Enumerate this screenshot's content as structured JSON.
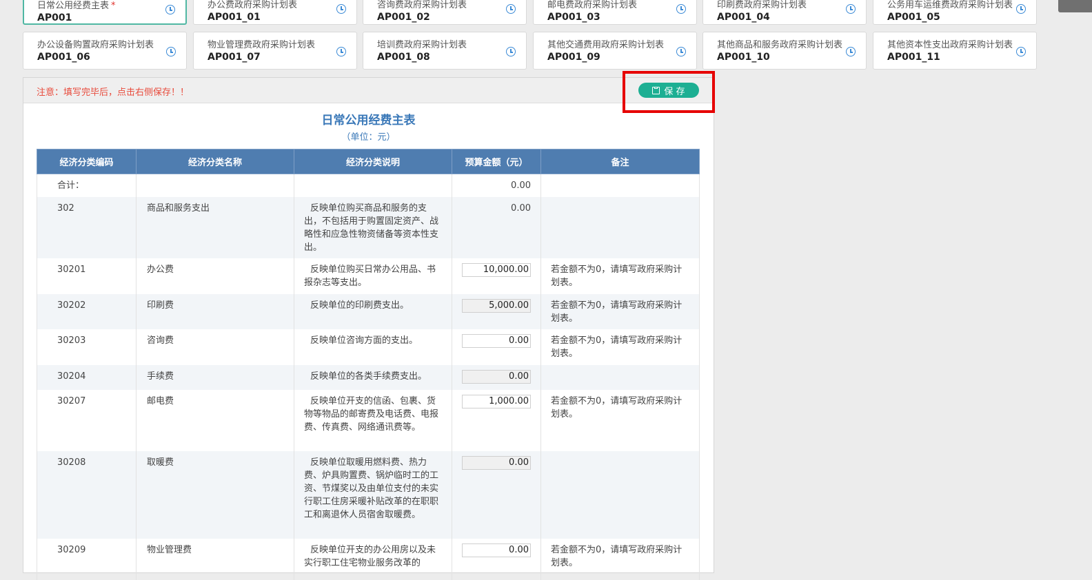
{
  "cards": [
    {
      "title": "日常公用经费主表",
      "code": "AP001",
      "required_mark": "*"
    },
    {
      "title": "办公费政府采购计划表",
      "code": "AP001_01"
    },
    {
      "title": "咨询费政府采购计划表",
      "code": "AP001_02"
    },
    {
      "title": "邮电费政府采购计划表",
      "code": "AP001_03"
    },
    {
      "title": "印刷费政府采购计划表",
      "code": "AP001_04"
    },
    {
      "title": "公务用车运维费政府采购计划表",
      "code": "AP001_05"
    },
    {
      "title": "办公设备购置政府采购计划表",
      "code": "AP001_06"
    },
    {
      "title": "物业管理费政府采购计划表",
      "code": "AP001_07"
    },
    {
      "title": "培训费政府采购计划表",
      "code": "AP001_08"
    },
    {
      "title": "其他交通费用政府采购计划表",
      "code": "AP001_09"
    },
    {
      "title": "其他商品和服务政府采购计划表",
      "code": "AP001_10"
    },
    {
      "title": "其他资本性支出政府采购计划表",
      "code": "AP001_11"
    }
  ],
  "notice": "注意：填写完毕后，点击右侧保存！！",
  "save_label": "保 存",
  "sheet": {
    "title": "日常公用经费主表",
    "unit": "（单位：元）",
    "headers": [
      "经济分类编码",
      "经济分类名称",
      "经济分类说明",
      "预算金额（元）",
      "备注"
    ],
    "rows": [
      {
        "code": "合计：",
        "name": "",
        "desc": "",
        "amount": "0.00",
        "input": "none",
        "note": ""
      },
      {
        "code": "302",
        "name": "商品和服务支出",
        "desc": "反映单位购买商品和服务的支出，不包括用于购置固定资产、战略性和应急性物资储备等资本性支出。",
        "amount": "0.00",
        "input": "none",
        "note": ""
      },
      {
        "code": "30201",
        "name": "办公费",
        "desc": "反映单位购买日常办公用品、书报杂志等支出。",
        "amount": "10,000.00",
        "input": "edit",
        "note": "若金额不为0，请填写政府采购计划表。"
      },
      {
        "code": "30202",
        "name": "印刷费",
        "desc": "反映单位的印刷费支出。",
        "amount": "5,000.00",
        "input": "ro",
        "note": "若金额不为0，请填写政府采购计划表。"
      },
      {
        "code": "30203",
        "name": "咨询费",
        "desc": "反映单位咨询方面的支出。",
        "amount": "0.00",
        "input": "edit",
        "note": "若金额不为0，请填写政府采购计划表。"
      },
      {
        "code": "30204",
        "name": "手续费",
        "desc": "反映单位的各类手续费支出。",
        "amount": "0.00",
        "input": "ro",
        "note": ""
      },
      {
        "code": "30207",
        "name": "邮电费",
        "desc": "反映单位开支的信函、包裹、货物等物品的邮寄费及电话费、电报费、传真费、网络通讯费等。",
        "amount": "1,000.00",
        "input": "edit",
        "note": "若金额不为0，请填写政府采购计划表。"
      },
      {
        "code": "30208",
        "name": "取暖费",
        "desc": "反映单位取暖用燃料费、热力费、炉具购置费、锅炉临时工的工资、节煤奖以及由单位支付的未实行职工住房采暖补贴改革的在职职工和离退休人员宿舍取暖费。",
        "amount": "0.00",
        "input": "ro",
        "note": ""
      },
      {
        "code": "30209",
        "name": "物业管理费",
        "desc": "反映单位开支的办公用房以及未实行职工住宅物业服务改革的",
        "amount": "0.00",
        "input": "edit",
        "note": "若金额不为0，请填写政府采购计划表。"
      }
    ]
  },
  "colors": {
    "accent": "#1daf93",
    "header_blue": "#4f7db0",
    "title_blue": "#3a78b8",
    "notice_red": "#e84b3c",
    "highlight": "#e60000"
  }
}
